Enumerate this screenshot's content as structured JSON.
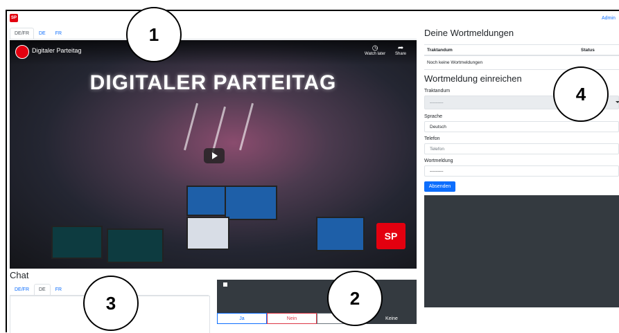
{
  "logo": {
    "text": "SP"
  },
  "header": {
    "admin_link": "Admin"
  },
  "video_tabs": [
    {
      "label": "DE/FR",
      "active": true
    },
    {
      "label": "DE"
    },
    {
      "label": "FR"
    }
  ],
  "video": {
    "title": "Digitaler Parteitag",
    "banner": "DIGITALER PARTEITAG",
    "watch_later": "Watch later",
    "share": "Share",
    "badge": "SP"
  },
  "chat": {
    "title": "Chat",
    "tabs": [
      {
        "label": "DE/FR"
      },
      {
        "label": "DE",
        "active": true
      },
      {
        "label": "FR"
      }
    ]
  },
  "vote": {
    "buttons": {
      "ja": "Ja",
      "nein": "Nein",
      "enthaltung": "Enth",
      "keine": "Keine"
    }
  },
  "wortmeldungen": {
    "title": "Deine Wortmeldungen",
    "columns": [
      "Traktandum",
      "Status"
    ],
    "empty": "Noch keine Wortmeldungen"
  },
  "form": {
    "title": "Wortmeldung einreichen",
    "traktandum_label": "Traktandum",
    "traktandum_value": "---------",
    "sprache_label": "Sprache",
    "sprache_value": "Deutsch",
    "telefon_label": "Telefon",
    "telefon_placeholder": "Telefon",
    "wortmeldung_label": "Wortmeldung",
    "wortmeldung_value": "---------",
    "submit": "Absenden"
  },
  "callouts": [
    "1",
    "2",
    "3",
    "4"
  ],
  "colors": {
    "accent": "#0d6efd",
    "brand": "#e3000f",
    "dark_panel": "#343a40",
    "danger": "#dc3545"
  }
}
